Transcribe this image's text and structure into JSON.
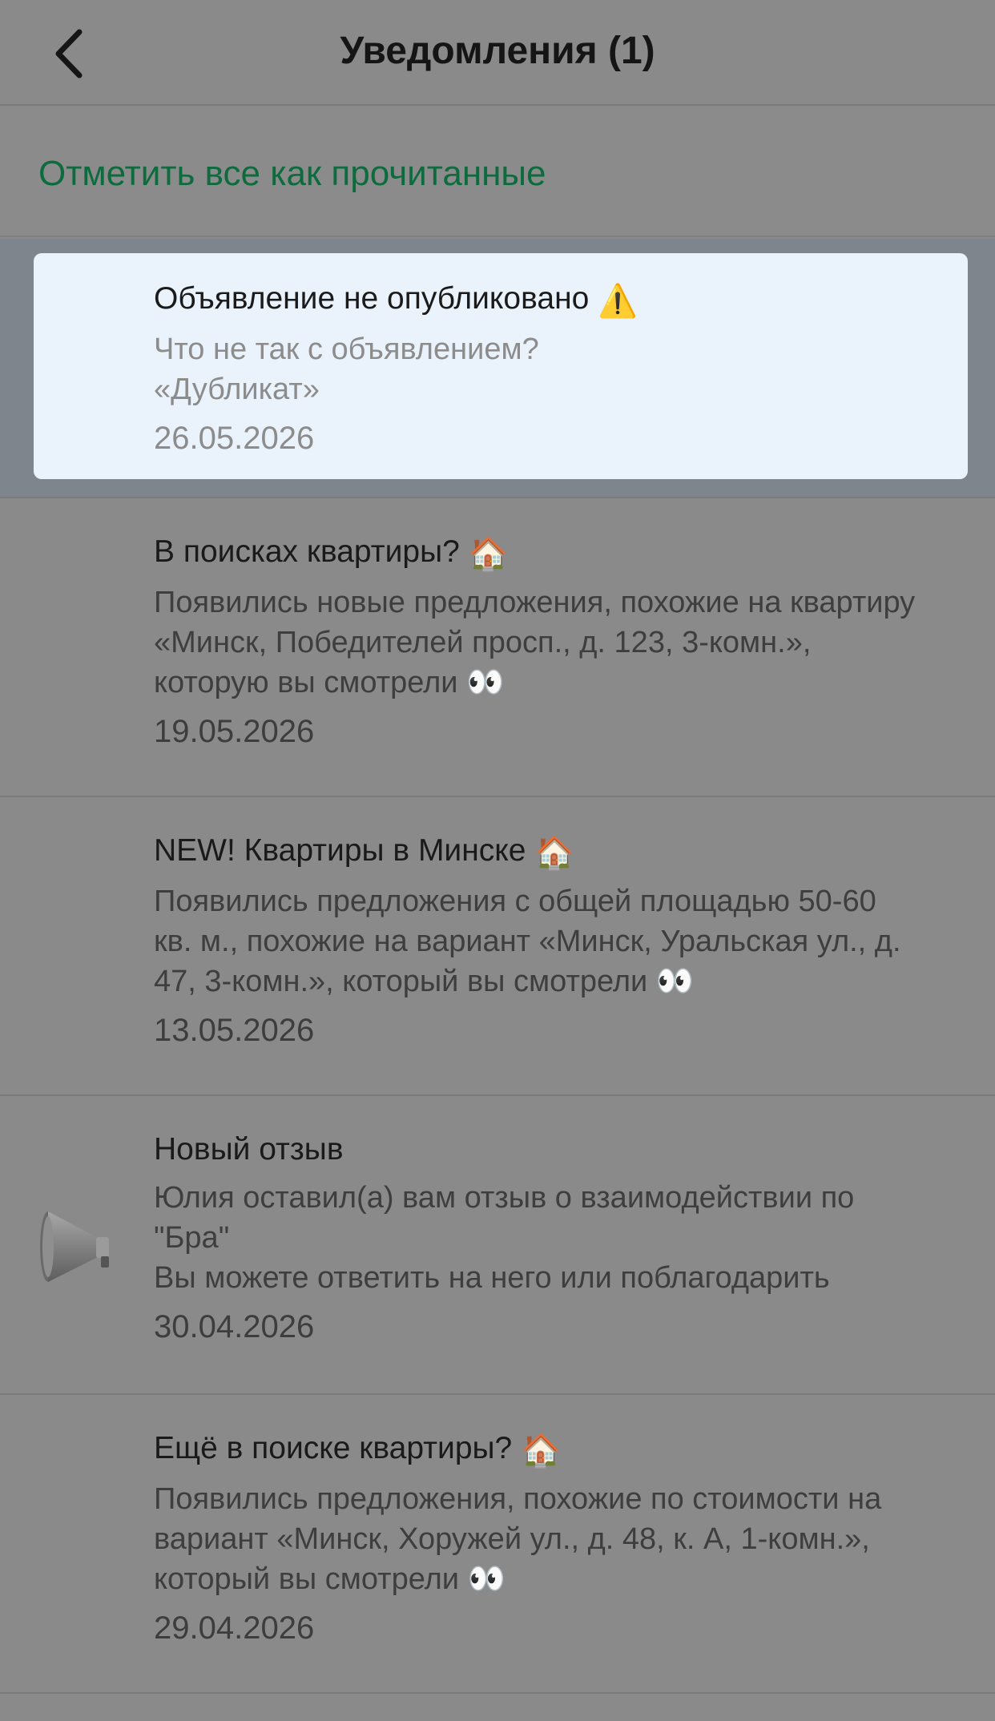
{
  "header": {
    "title": "Уведомления (1)"
  },
  "actions": {
    "mark_all_label": "Отметить все как прочитанные"
  },
  "notifications": [
    {
      "title": "Объявление не опубликовано",
      "title_emoji": "⚠️",
      "text_lines": [
        "Что не так с объявлением?",
        "«Дубликат»"
      ],
      "date": "26.05.2026",
      "unread": true
    },
    {
      "title": "В поисках квартиры?",
      "title_emoji": "🏠",
      "text_lines": [
        "Появились новые предложения, похожие на квартиру",
        "«Минск, Победителей просп., д. 123, 3-комн.»,",
        "которую вы смотрели 👀"
      ],
      "date": "19.05.2026"
    },
    {
      "title": "NEW! Квартиры в Минске",
      "title_emoji": "🏠",
      "text_lines": [
        "Появились предложения с общей площадью 50-60",
        "кв. м., похожие на вариант «Минск, Уральская ул., д.",
        "47, 3-комн.», который вы смотрели 👀"
      ],
      "date": "13.05.2026"
    },
    {
      "title": "Новый отзыв",
      "title_emoji": "",
      "icon": "megaphone-icon",
      "text_lines": [
        "Юлия оставил(а) вам отзыв о взаимодействии по",
        "\"Бра\"",
        "Вы можете ответить на него или поблагодарить"
      ],
      "date": "30.04.2026"
    },
    {
      "title": "Ещё в поиске квартиры?",
      "title_emoji": "🏠",
      "text_lines": [
        "Появились предложения, похожие по стоимости на",
        "вариант  «Минск, Хоружей ул., д. 48, к. А, 1-комн.»,",
        "который вы смотрели 👀"
      ],
      "date": "29.04.2026"
    }
  ],
  "colors": {
    "accent_green": "#0d6b3e",
    "unread_card": "#eaf2fc",
    "overlay_gray": "#8a8a8a"
  }
}
